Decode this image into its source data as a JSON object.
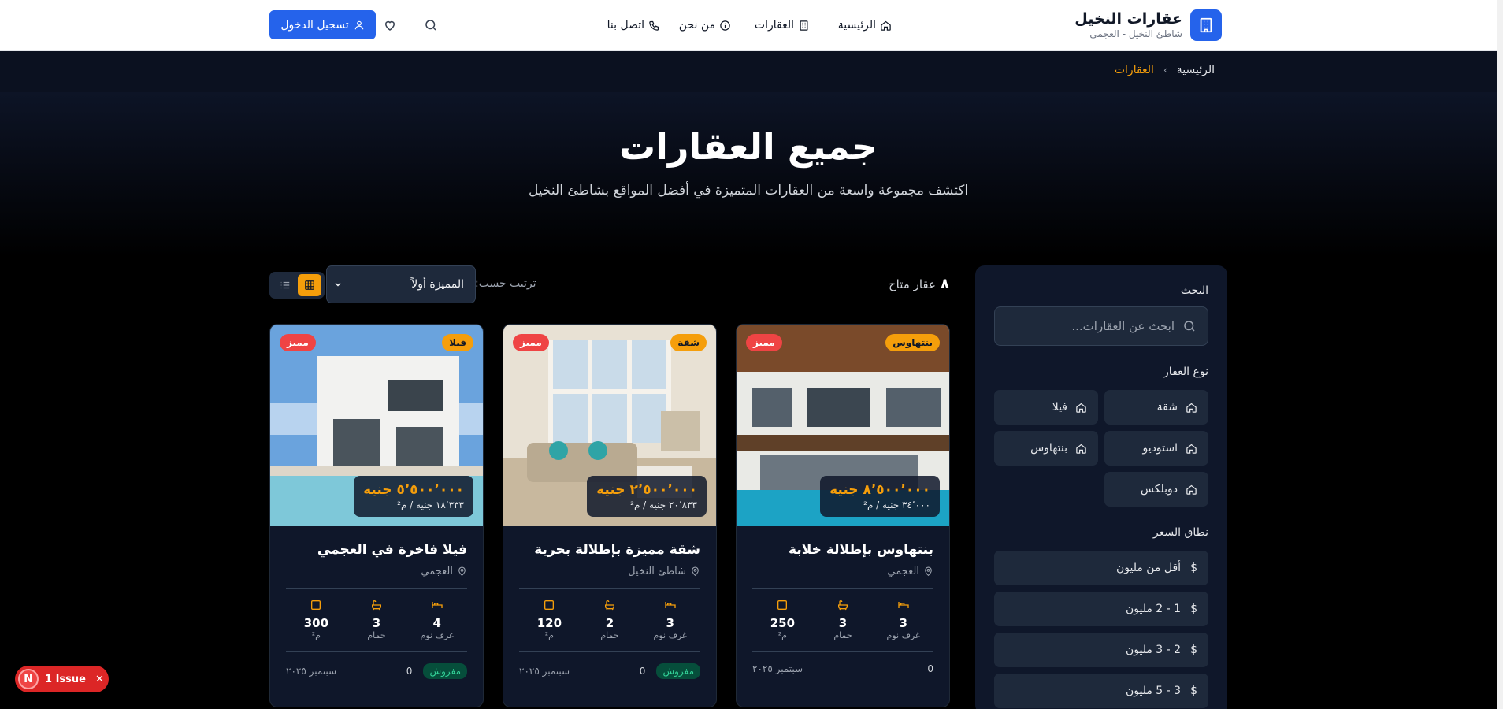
{
  "header": {
    "brand_name": "عقارات النخيل",
    "brand_sub": "شاطئ النخيل - العجمي",
    "nav": [
      "الرئيسية",
      "العقارات",
      "من نحن",
      "اتصل بنا"
    ],
    "login": "تسجيل الدخول"
  },
  "breadcrumb": {
    "home": "الرئيسية",
    "sep": "›",
    "current": "العقارات"
  },
  "hero": {
    "title": "جميع العقارات",
    "subtitle": "اكتشف مجموعة واسعة من العقارات المتميزة في أفضل المواقع بشاطئ النخيل"
  },
  "sidebar": {
    "search_label": "البحث",
    "search_placeholder": "ابحث عن العقارات...",
    "type_label": "نوع العقار",
    "types": [
      "شقة",
      "فيلا",
      "استوديو",
      "بنتهاوس",
      "دوبلكس"
    ],
    "price_label": "نطاق السعر",
    "prices": [
      "أقل من مليون",
      "1 - 2 مليون",
      "2 - 3 مليون",
      "3 - 5 مليون"
    ]
  },
  "toolbar": {
    "count": "٨",
    "count_label": "عقار متاح",
    "sort_label": "ترتيب حسب:",
    "sort_value": "المميزة أولاً"
  },
  "cards": [
    {
      "type": "بنتهاوس",
      "featured": "مميز",
      "price": "٨٬٥٠٠٬٠٠٠ جنيه",
      "ppm": "٣٤٬٠٠٠ جنيه / م²",
      "title": "بنتهاوس بإطلالة خلابة",
      "location": "العجمي",
      "beds": "3",
      "baths": "3",
      "area": "250",
      "beds_lbl": "غرف نوم",
      "baths_lbl": "حمام",
      "area_lbl": "م²",
      "furnished": "",
      "views": "0",
      "date": "سبتمبر ٢٠٢٥"
    },
    {
      "type": "شقة",
      "featured": "مميز",
      "price": "٢٬٥٠٠٬٠٠٠ جنيه",
      "ppm": "٢٠٬٨٣٣ جنيه / م²",
      "title": "شقة مميزة بإطلالة بحرية",
      "location": "شاطئ النخيل",
      "beds": "3",
      "baths": "2",
      "area": "120",
      "beds_lbl": "غرف نوم",
      "baths_lbl": "حمام",
      "area_lbl": "م²",
      "furnished": "مفروش",
      "views": "0",
      "date": "سبتمبر ٢٠٢٥"
    },
    {
      "type": "فيلا",
      "featured": "مميز",
      "price": "٥٬٥٠٠٬٠٠٠ جنيه",
      "ppm": "١٨٬٣٣٣ جنيه / م²",
      "title": "فيلا فاخرة في العجمي",
      "location": "العجمي",
      "beds": "4",
      "baths": "3",
      "area": "300",
      "beds_lbl": "غرف نوم",
      "baths_lbl": "حمام",
      "area_lbl": "م²",
      "furnished": "مفروش",
      "views": "0",
      "date": "سبتمبر ٢٠٢٥"
    }
  ],
  "issue": {
    "letter": "N",
    "label": "1 Issue"
  }
}
